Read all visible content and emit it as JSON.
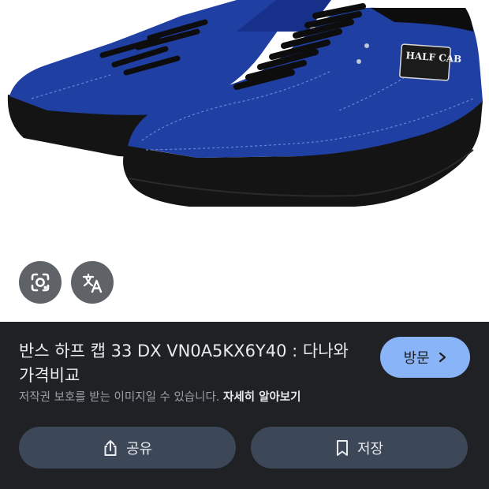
{
  "result": {
    "title": "반스 하프 캡 33 DX VN0A5KX6Y40 : 다나와 가격비교",
    "visit_label": "방문",
    "copyright_notice": "저작권 보호를 받는 이미지일 수 있습니다.",
    "learn_more": "자세히 알아보기"
  },
  "actions": {
    "share_label": "공유",
    "save_label": "저장"
  },
  "image": {
    "patch_text": "HALF CAB"
  },
  "icons": {
    "lens": "google-lens-icon",
    "translate": "translate-icon",
    "visit_arrow": "chevron-right-icon",
    "share": "share-icon",
    "save": "bookmark-icon"
  },
  "colors": {
    "panel_bg": "#202124",
    "visit_button": "#8ab4f8",
    "pill_bg": "#3c4758",
    "fab_bg": "#5f6368",
    "shoe_blue": "#1f3fa3",
    "sole_black": "#141414"
  }
}
